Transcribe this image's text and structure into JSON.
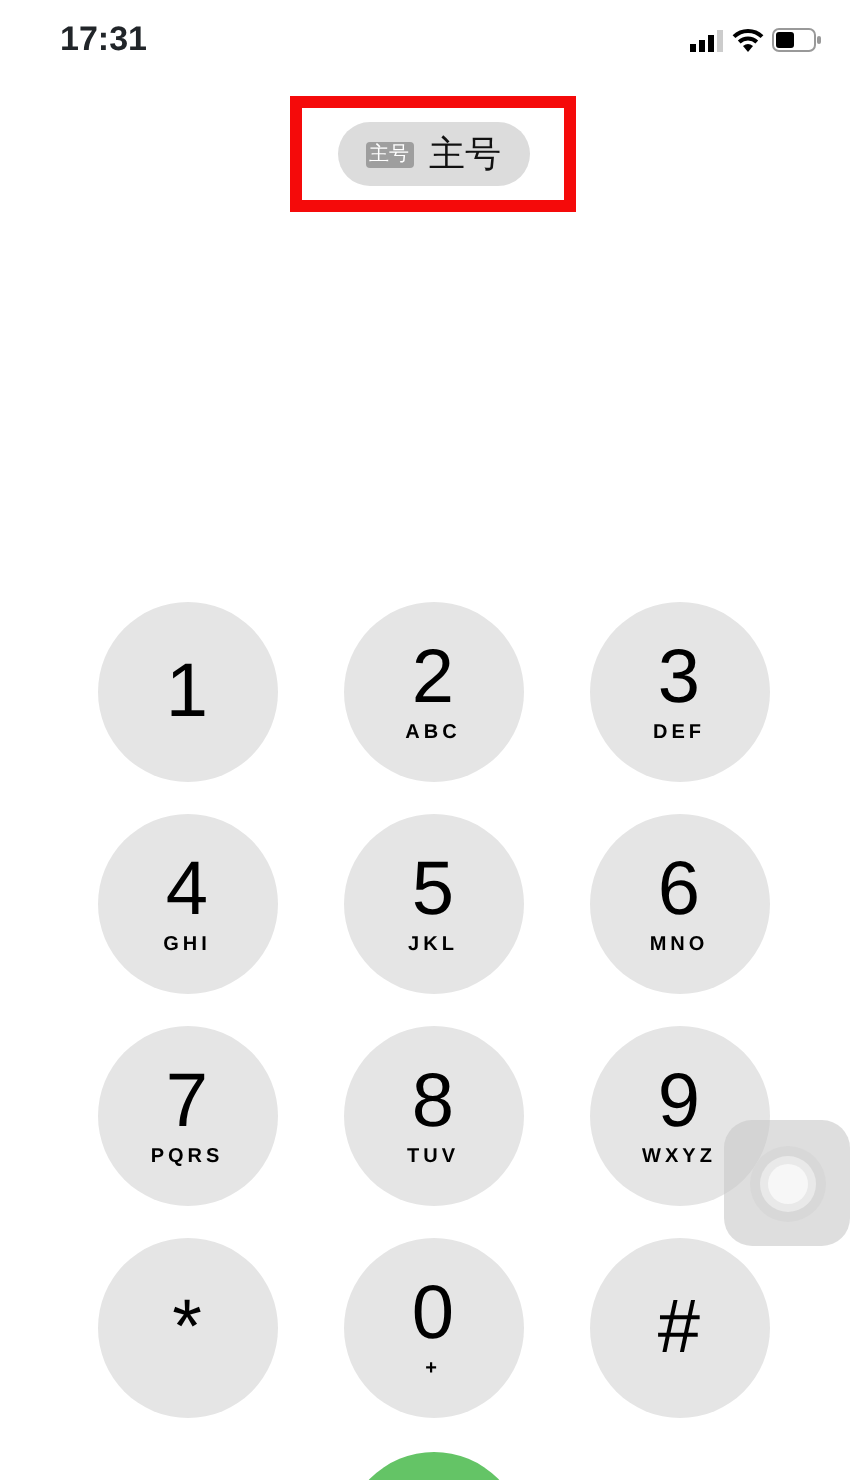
{
  "status_bar": {
    "time": "17:31"
  },
  "line_selector": {
    "badge": "主号",
    "label": "主号",
    "highlighted": true
  },
  "keypad": [
    {
      "digit": "1"
    },
    {
      "digit": "2",
      "letters": "ABC"
    },
    {
      "digit": "3",
      "letters": "DEF"
    },
    {
      "digit": "4",
      "letters": "GHI"
    },
    {
      "digit": "5",
      "letters": "JKL"
    },
    {
      "digit": "6",
      "letters": "MNO"
    },
    {
      "digit": "7",
      "letters": "PQRS"
    },
    {
      "digit": "8",
      "letters": "TUV"
    },
    {
      "digit": "9",
      "letters": "WXYZ"
    },
    {
      "digit": "*"
    },
    {
      "digit": "0",
      "letters": "+"
    },
    {
      "digit": "#"
    }
  ]
}
